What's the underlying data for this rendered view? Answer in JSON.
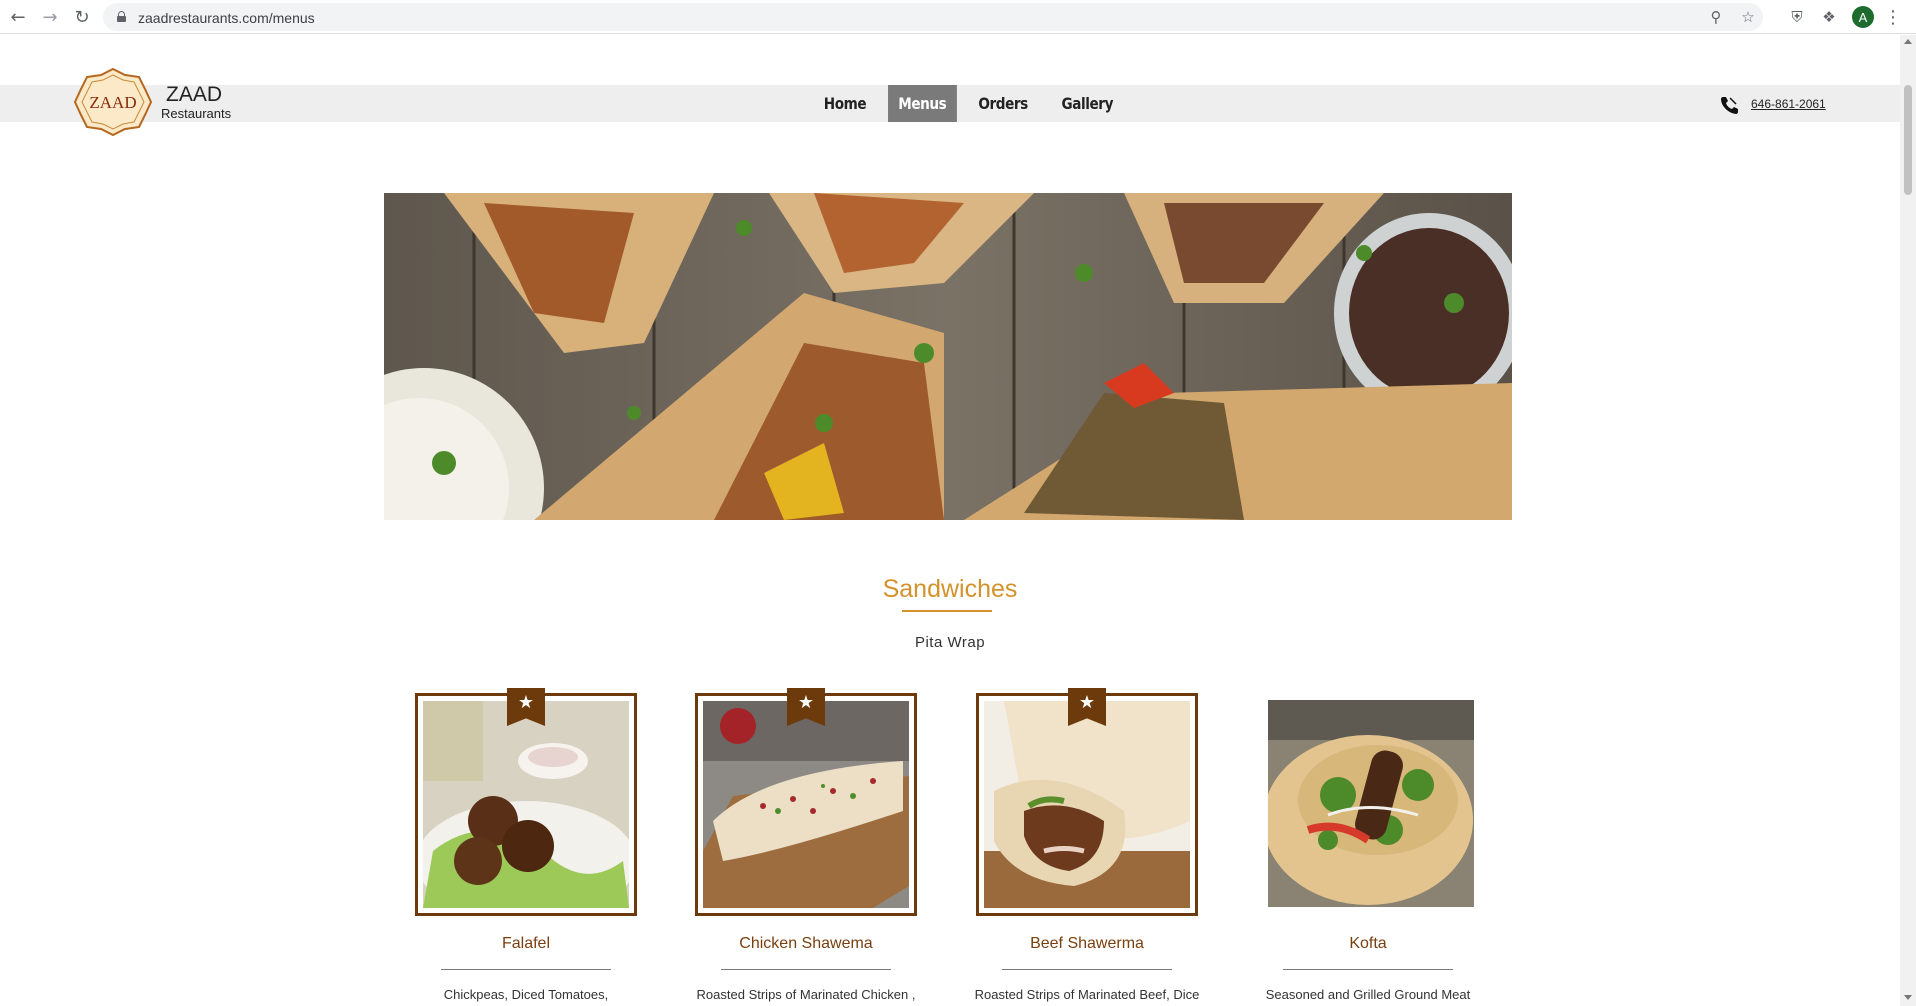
{
  "browser": {
    "url": "zaadrestaurants.com/menus",
    "profile_initial": "A"
  },
  "site": {
    "brand_name": "ZAAD",
    "brand_sub": "Restaurants",
    "logo_text": "ZAAD",
    "nav": [
      {
        "label": "Home",
        "active": false
      },
      {
        "label": "Menus",
        "active": true
      },
      {
        "label": "Orders",
        "active": false
      },
      {
        "label": "Gallery",
        "active": false
      }
    ],
    "phone": "646-861-2061"
  },
  "section": {
    "title": "Sandwiches",
    "subtitle": "Pita Wrap"
  },
  "items": [
    {
      "name": "Falafel",
      "desc": "Chickpeas, Diced Tomatoes,",
      "featured": true
    },
    {
      "name": "Chicken Shawema",
      "desc": "Roasted Strips of Marinated Chicken ,",
      "featured": true
    },
    {
      "name": "Beef Shawerma",
      "desc": "Roasted Strips of Marinated Beef, Dice",
      "featured": true
    },
    {
      "name": "Kofta",
      "desc": "Seasoned and Grilled Ground Meat",
      "featured": false
    }
  ],
  "colors": {
    "accent": "#d4922c",
    "frame": "#6d3b0b",
    "item_name": "#7a3f0e"
  }
}
